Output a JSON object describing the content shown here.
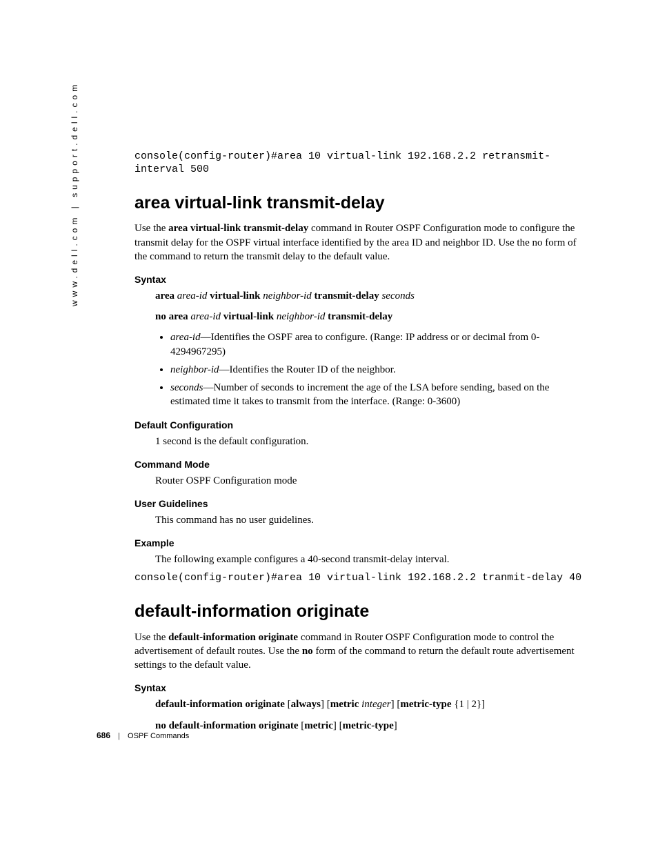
{
  "sidebar": "www.dell.com | support.dell.com",
  "code1": "console(config-router)#area 10 virtual-link 192.168.2.2 retransmit-interval 500",
  "sec1": {
    "title": "area virtual-link transmit-delay",
    "intro_pre": "Use the ",
    "intro_bold": "area virtual-link transmit-delay",
    "intro_post": " command in Router OSPF Configuration mode to configure the transmit delay for the OSPF virtual interface identified by the area ID and neighbor ID. Use the no form of the command to return the transmit delay to the default value.",
    "syntax_head": "Syntax",
    "syn1": {
      "t1": "area ",
      "t2": "area-id",
      "t3": " virtual-link ",
      "t4": "neighbor-id ",
      "t5": " transmit-delay ",
      "t6": "seconds"
    },
    "syn2": {
      "t1": "no area ",
      "t2": "area-id",
      "t3": " virtual-link ",
      "t4": "neighbor-id ",
      "t5": " transmit-delay"
    },
    "b1": {
      "i": "area-id",
      "r": "—Identifies the OSPF area to configure. (Range: IP address or or decimal from 0-4294967295)"
    },
    "b2": {
      "i": "neighbor-id",
      "r": "—Identifies the Router ID of the neighbor."
    },
    "b3": {
      "i": "seconds",
      "r": "—Number of seconds to increment the age of the LSA before sending, based on the estimated time it takes to transmit from the interface. (Range: 0-3600)"
    },
    "defcfg_head": "Default Configuration",
    "defcfg_body": "1 second is the default configuration.",
    "cmdmode_head": "Command Mode",
    "cmdmode_body": "Router OSPF Configuration mode",
    "ugl_head": "User Guidelines",
    "ugl_body": "This command has no user guidelines.",
    "ex_head": "Example",
    "ex_body": "The following example configures a 40-second transmit-delay interval.",
    "ex_code": "console(config-router)#area 10 virtual-link 192.168.2.2 tranmit-delay 40"
  },
  "sec2": {
    "title": "default-information originate",
    "intro_pre": "Use the ",
    "intro_bold": "default-information originate",
    "intro_mid": " command in Router OSPF Configuration mode to control the advertisement of default routes. Use the ",
    "intro_bold2": "no",
    "intro_post": " form of the command to return the default route advertisement settings to the default value.",
    "syntax_head": "Syntax",
    "syn1": {
      "t1": "default-information originate",
      "t2": " [",
      "t3": "always",
      "t4": "] [",
      "t5": "metric ",
      "t6": "integer",
      "t7": "] [",
      "t8": "metric-type",
      "t9": " {1 | 2}]"
    },
    "syn2": {
      "t1": "no default-information originate",
      "t2": " [",
      "t3": "metric",
      "t4": "] [",
      "t5": "metric-type",
      "t6": "]"
    }
  },
  "footer": {
    "page": "686",
    "sep": "|",
    "label": "OSPF Commands"
  }
}
